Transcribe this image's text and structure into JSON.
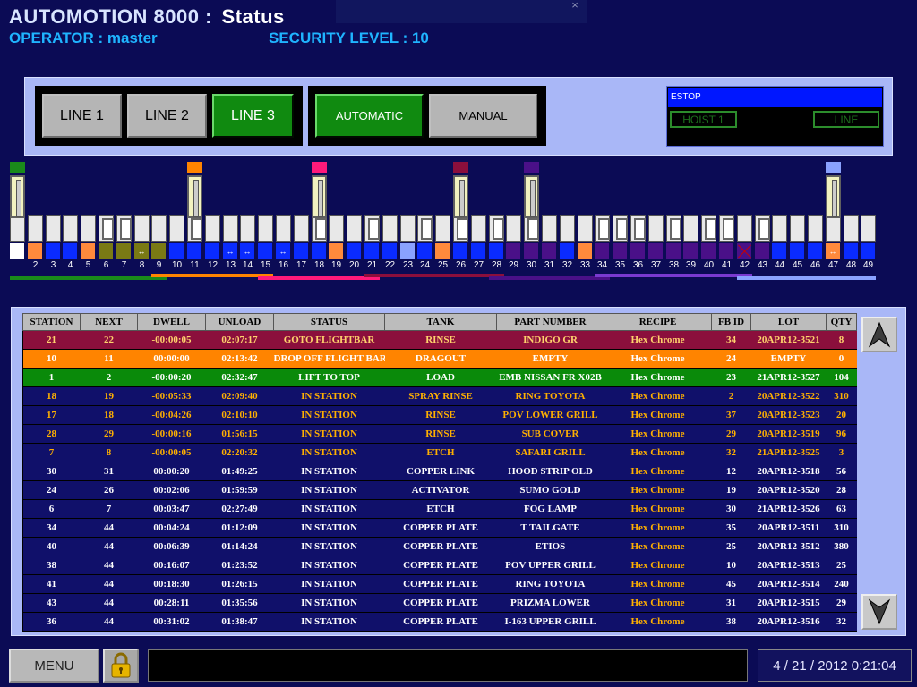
{
  "header": {
    "app": "AUTOMOTION 8000 :",
    "screen": "Status",
    "operator": "OPERATOR : master",
    "security": "SECURITY LEVEL : 10",
    "close": "×"
  },
  "controls": {
    "lines": [
      {
        "label": "LINE 1",
        "active": false
      },
      {
        "label": "LINE 2",
        "active": false
      },
      {
        "label": "LINE 3",
        "active": true
      }
    ],
    "modes": [
      {
        "label": "AUTOMATIC",
        "active": true
      },
      {
        "label": "MANUAL",
        "active": false
      }
    ],
    "estop": "ESTOP",
    "hoist_indicator": "HOIST 1",
    "line_indicator": "LINE"
  },
  "stations": {
    "numbers": [
      "",
      "2",
      "3",
      "4",
      "5",
      "6",
      "7",
      "8",
      "9",
      "10",
      "11",
      "12",
      "13",
      "14",
      "15",
      "16",
      "17",
      "18",
      "19",
      "20",
      "21",
      "22",
      "23",
      "24",
      "25",
      "26",
      "27",
      "28",
      "29",
      "30",
      "31",
      "32",
      "33",
      "34",
      "35",
      "36",
      "37",
      "38",
      "39",
      "40",
      "41",
      "42",
      "43",
      "44",
      "45",
      "46",
      "47",
      "48",
      "49"
    ],
    "cell_colors": [
      "#ffffff",
      "#ff8a3c",
      "#0a2bff",
      "#0a2bff",
      "#ff8a3c",
      "#7a7a14",
      "#7a7a14",
      "#7a7a14",
      "#7a7a14",
      "#0a2bff",
      "#0a2bff",
      "#0a2bff",
      "#0a2bff",
      "#0a2bff",
      "#0a2bff",
      "#0a2bff",
      "#0a2bff",
      "#0a2bff",
      "#ff8a3c",
      "#0a2bff",
      "#0a2bff",
      "#0a2bff",
      "#8aa2ff",
      "#0a2bff",
      "#ff8a3c",
      "#0a2bff",
      "#0a2bff",
      "#0a2bff",
      "#4a1088",
      "#4a1088",
      "#4a1088",
      "#0a2bff",
      "#ff8a3c",
      "#4a1088",
      "#4a1088",
      "#4a1088",
      "#4a1088",
      "#4a1088",
      "#4a1088",
      "#4a1088",
      "#4a1088",
      "#4a1088",
      "#4a1088",
      "#0a2bff",
      "#0a2bff",
      "#0a2bff",
      "#ff8a3c",
      "#0a2bff",
      "#0a2bff"
    ],
    "transfer_arrow": "↔",
    "arrow_stations": [
      8,
      13,
      14,
      16,
      47
    ],
    "empty_stations": [
      42
    ],
    "active_tanks": [
      6,
      7,
      11,
      18,
      21,
      24,
      26,
      28,
      30,
      34,
      35,
      36,
      38,
      40,
      41,
      43
    ],
    "hoists": [
      {
        "station": 1,
        "flag_color": "#1a8a1a"
      },
      {
        "station": 11,
        "flag_color": "#ff8400"
      },
      {
        "station": 18,
        "flag_color": "#ff1a7a"
      },
      {
        "station": 26,
        "flag_color": "#8b0f3c"
      },
      {
        "station": 30,
        "flag_color": "#4a1088"
      },
      {
        "station": 47,
        "flag_color": "#8aa2ff"
      }
    ],
    "zones": [
      {
        "from": 1,
        "to": 9,
        "color": "#1a8a1a"
      },
      {
        "from": 9,
        "to": 15,
        "color": "#ff8400"
      },
      {
        "from": 15,
        "to": 21,
        "color": "#ff1a7a"
      },
      {
        "from": 21,
        "to": 28,
        "color": "#8b0f3c"
      },
      {
        "from": 28,
        "to": 34,
        "color": "#4a1088"
      },
      {
        "from": 34,
        "to": 42,
        "color": "#7a3ad0"
      },
      {
        "from": 42,
        "to": 49,
        "color": "#8aa2ff"
      }
    ]
  },
  "table": {
    "headers": [
      "STATION",
      "NEXT",
      "DWELL",
      "UNLOAD",
      "STATUS",
      "TANK",
      "PART NUMBER",
      "RECIPE",
      "FB ID",
      "LOT",
      "QTY"
    ],
    "rows": [
      {
        "style": "maroon",
        "cells": [
          "21",
          "22",
          "-00:00:05",
          "02:07:17",
          "GOTO FLIGHTBAR",
          "RINSE",
          "INDIGO GR",
          "Hex Chrome",
          "34",
          "20APR12-3521",
          "8"
        ]
      },
      {
        "style": "orange",
        "cells": [
          "10",
          "11",
          "00:00:00",
          "02:13:42",
          "DROP OFF FLIGHT BAR",
          "DRAGOUT",
          "EMPTY",
          "Hex Chrome",
          "24",
          "EMPTY",
          "0"
        ]
      },
      {
        "style": "green",
        "cells": [
          "1",
          "2",
          "-00:00:20",
          "02:32:47",
          "LIFT TO TOP",
          "LOAD",
          "EMB NISSAN FR X02B",
          "Hex Chrome",
          "23",
          "21APR12-3527",
          "104"
        ]
      },
      {
        "style": "yellow",
        "cells": [
          "18",
          "19",
          "-00:05:33",
          "02:09:40",
          "IN STATION",
          "SPRAY RINSE",
          "RING TOYOTA",
          "Hex Chrome",
          "2",
          "20APR12-3522",
          "310"
        ]
      },
      {
        "style": "yellow",
        "cells": [
          "17",
          "18",
          "-00:04:26",
          "02:10:10",
          "IN STATION",
          "RINSE",
          "POV LOWER GRILL",
          "Hex Chrome",
          "37",
          "20APR12-3523",
          "20"
        ]
      },
      {
        "style": "yellow",
        "cells": [
          "28",
          "29",
          "-00:00:16",
          "01:56:15",
          "IN STATION",
          "RINSE",
          "SUB COVER",
          "Hex Chrome",
          "29",
          "20APR12-3519",
          "96"
        ]
      },
      {
        "style": "yellow",
        "cells": [
          "7",
          "8",
          "-00:00:05",
          "02:20:32",
          "IN STATION",
          "ETCH",
          "SAFARI GRILL",
          "Hex Chrome",
          "32",
          "21APR12-3525",
          "3"
        ]
      },
      {
        "style": "white",
        "cells": [
          "30",
          "31",
          "00:00:20",
          "01:49:25",
          "IN STATION",
          "COPPER LINK",
          "HOOD STRIP OLD",
          "Hex Chrome",
          "12",
          "20APR12-3518",
          "56"
        ]
      },
      {
        "style": "white",
        "cells": [
          "24",
          "26",
          "00:02:06",
          "01:59:59",
          "IN STATION",
          "ACTIVATOR",
          "SUMO GOLD",
          "Hex Chrome",
          "19",
          "20APR12-3520",
          "28"
        ]
      },
      {
        "style": "white",
        "cells": [
          "6",
          "7",
          "00:03:47",
          "02:27:49",
          "IN STATION",
          "ETCH",
          "FOG LAMP",
          "Hex Chrome",
          "30",
          "21APR12-3526",
          "63"
        ]
      },
      {
        "style": "white",
        "cells": [
          "34",
          "44",
          "00:04:24",
          "01:12:09",
          "IN STATION",
          "COPPER PLATE",
          "T TAILGATE",
          "Hex Chrome",
          "35",
          "20APR12-3511",
          "310"
        ]
      },
      {
        "style": "white",
        "cells": [
          "40",
          "44",
          "00:06:39",
          "01:14:24",
          "IN STATION",
          "COPPER PLATE",
          "ETIOS",
          "Hex Chrome",
          "25",
          "20APR12-3512",
          "380"
        ]
      },
      {
        "style": "white",
        "cells": [
          "38",
          "44",
          "00:16:07",
          "01:23:52",
          "IN STATION",
          "COPPER PLATE",
          "POV UPPER GRILL",
          "Hex Chrome",
          "10",
          "20APR12-3513",
          "25"
        ]
      },
      {
        "style": "white",
        "cells": [
          "41",
          "44",
          "00:18:30",
          "01:26:15",
          "IN STATION",
          "COPPER PLATE",
          "RING TOYOTA",
          "Hex Chrome",
          "45",
          "20APR12-3514",
          "240"
        ]
      },
      {
        "style": "white",
        "cells": [
          "43",
          "44",
          "00:28:11",
          "01:35:56",
          "IN STATION",
          "COPPER PLATE",
          "PRIZMA LOWER",
          "Hex Chrome",
          "31",
          "20APR12-3515",
          "29"
        ]
      },
      {
        "style": "white",
        "cells": [
          "36",
          "44",
          "00:31:02",
          "01:38:47",
          "IN STATION",
          "COPPER PLATE",
          "I-163 UPPER GRILL",
          "Hex Chrome",
          "38",
          "20APR12-3516",
          "32"
        ]
      }
    ]
  },
  "footer": {
    "menu": "MENU",
    "datetime": "4 / 21 / 2012   0:21:04"
  },
  "colors": {
    "background": "#0b0b55",
    "panel": "#a9b7f7",
    "active_green": "#108a10"
  }
}
